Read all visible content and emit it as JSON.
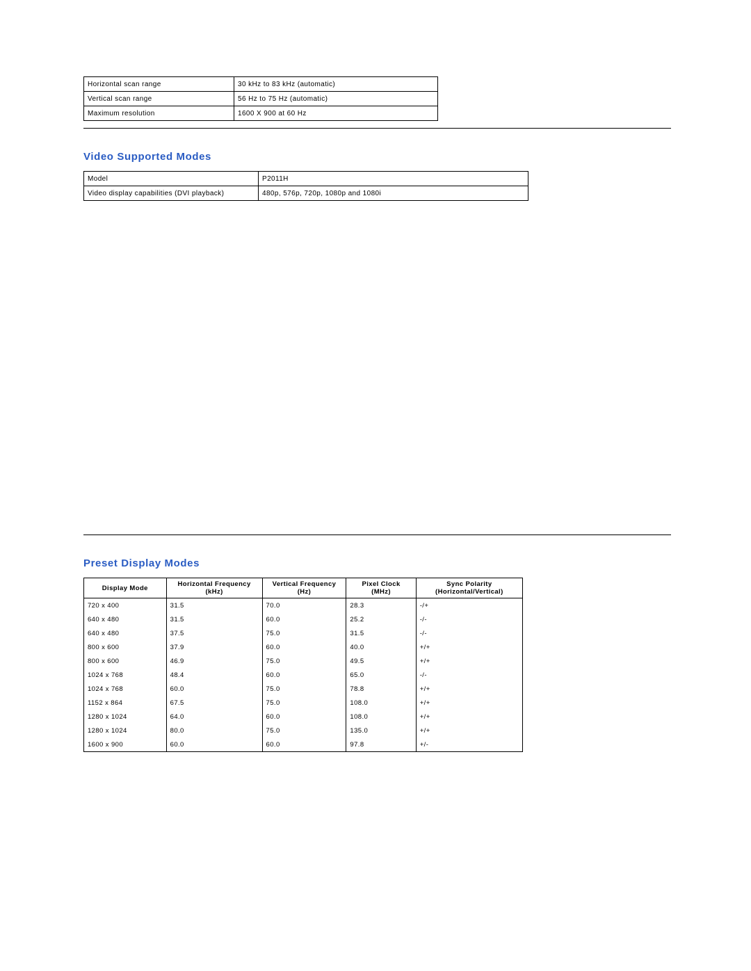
{
  "scan_table": {
    "rows": [
      {
        "label": "Horizontal scan range",
        "value": "30 kHz to 83 kHz (automatic)"
      },
      {
        "label": "Vertical scan range",
        "value": "56 Hz to 75 Hz (automatic)"
      },
      {
        "label": "Maximum resolution",
        "value": "1600 X 900 at 60 Hz"
      }
    ]
  },
  "sections": {
    "video_title": "Video Supported Modes",
    "preset_title": "Preset Display Modes"
  },
  "video_table": {
    "rows": [
      {
        "label": "Model",
        "value": "P2011H"
      },
      {
        "label": "Video display capabilities (DVI playback)",
        "value": "480p, 576p, 720p, 1080p and 1080i"
      }
    ]
  },
  "preset_table": {
    "headers": {
      "mode": "Display Mode",
      "hfreq": "Horizontal Frequency\n(kHz)",
      "vfreq": "Vertical Frequency\n(Hz)",
      "pclk": "Pixel Clock\n(MHz)",
      "sync": "Sync Polarity\n(Horizontal/Vertical)"
    },
    "rows": [
      {
        "mode": "720 x 400",
        "hfreq": "31.5",
        "vfreq": "70.0",
        "pclk": "28.3",
        "sync": "-/+"
      },
      {
        "mode": "640 x 480",
        "hfreq": "31.5",
        "vfreq": "60.0",
        "pclk": "25.2",
        "sync": "-/-"
      },
      {
        "mode": "640 x 480",
        "hfreq": "37.5",
        "vfreq": "75.0",
        "pclk": "31.5",
        "sync": "-/-"
      },
      {
        "mode": "800 x 600",
        "hfreq": "37.9",
        "vfreq": "60.0",
        "pclk": "40.0",
        "sync": "+/+"
      },
      {
        "mode": "800 x 600",
        "hfreq": "46.9",
        "vfreq": "75.0",
        "pclk": "49.5",
        "sync": "+/+"
      },
      {
        "mode": "1024 x 768",
        "hfreq": "48.4",
        "vfreq": "60.0",
        "pclk": "65.0",
        "sync": "-/-"
      },
      {
        "mode": "1024 x 768",
        "hfreq": "60.0",
        "vfreq": "75.0",
        "pclk": "78.8",
        "sync": "+/+"
      },
      {
        "mode": "1152 x 864",
        "hfreq": "67.5",
        "vfreq": "75.0",
        "pclk": "108.0",
        "sync": "+/+"
      },
      {
        "mode": "1280 x 1024",
        "hfreq": "64.0",
        "vfreq": "60.0",
        "pclk": "108.0",
        "sync": "+/+"
      },
      {
        "mode": "1280 x 1024",
        "hfreq": "80.0",
        "vfreq": "75.0",
        "pclk": "135.0",
        "sync": "+/+"
      },
      {
        "mode": "1600 x 900",
        "hfreq": "60.0",
        "vfreq": "60.0",
        "pclk": "97.8",
        "sync": "+/-"
      }
    ]
  }
}
